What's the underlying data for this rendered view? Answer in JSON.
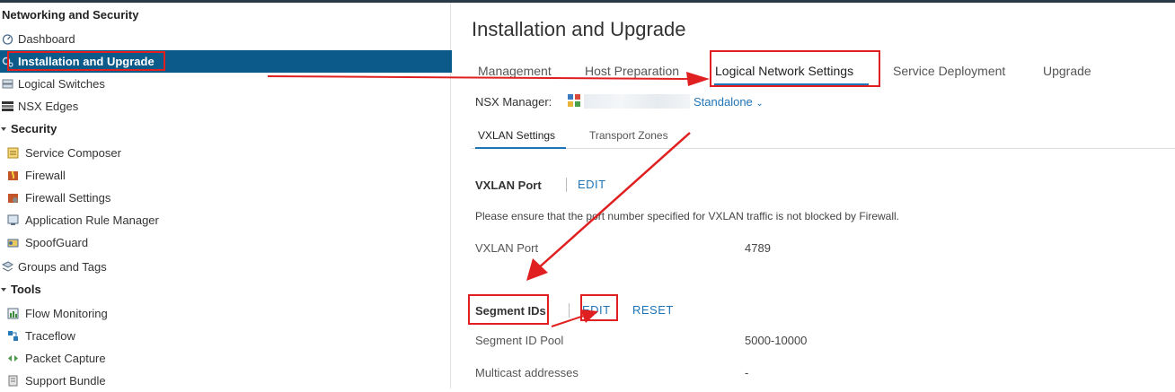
{
  "sidebar": {
    "title": "Networking and Security",
    "items": [
      {
        "label": "Dashboard",
        "icon": "dashboard-icon"
      },
      {
        "label": "Installation and Upgrade",
        "icon": "gears-icon",
        "active": true
      },
      {
        "label": "Logical Switches",
        "icon": "switches-icon"
      },
      {
        "label": "NSX Edges",
        "icon": "edges-icon"
      }
    ],
    "security": {
      "label": "Security",
      "items": [
        {
          "label": "Service Composer",
          "icon": "composer-icon"
        },
        {
          "label": "Firewall",
          "icon": "firewall-icon"
        },
        {
          "label": "Firewall Settings",
          "icon": "firewall-settings-icon"
        },
        {
          "label": "Application Rule Manager",
          "icon": "rule-manager-icon"
        },
        {
          "label": "SpoofGuard",
          "icon": "spoofguard-icon"
        }
      ]
    },
    "groups": {
      "label": "Groups and Tags",
      "icon": "groups-icon"
    },
    "tools": {
      "label": "Tools",
      "items": [
        {
          "label": "Flow Monitoring",
          "icon": "flow-monitor-icon"
        },
        {
          "label": "Traceflow",
          "icon": "traceflow-icon"
        },
        {
          "label": "Packet Capture",
          "icon": "packet-capture-icon"
        },
        {
          "label": "Support Bundle",
          "icon": "support-bundle-icon"
        }
      ]
    }
  },
  "main": {
    "title": "Installation and Upgrade",
    "tabs": [
      "Management",
      "Host Preparation",
      "Logical Network Settings",
      "Service Deployment",
      "Upgrade"
    ],
    "selected_tab": "Logical Network Settings",
    "nsx_manager_label": "NSX Manager:",
    "nsx_manager_mode": "Standalone",
    "subtabs": [
      "VXLAN Settings",
      "Transport Zones"
    ],
    "vxlan": {
      "heading": "VXLAN Port",
      "edit": "EDIT",
      "note": "Please ensure that the port number specified for VXLAN traffic is not blocked by Firewall.",
      "port_label": "VXLAN Port",
      "port_value": "4789"
    },
    "segment": {
      "heading": "Segment IDs",
      "edit": "EDIT",
      "reset": "RESET",
      "pool_label": "Segment ID Pool",
      "pool_value": "5000-10000",
      "multicast_label": "Multicast addresses",
      "multicast_value": "-"
    }
  },
  "colors": {
    "accent": "#1f74b6",
    "active_nav": "#0b5a8a",
    "annotation": "#e02020"
  }
}
